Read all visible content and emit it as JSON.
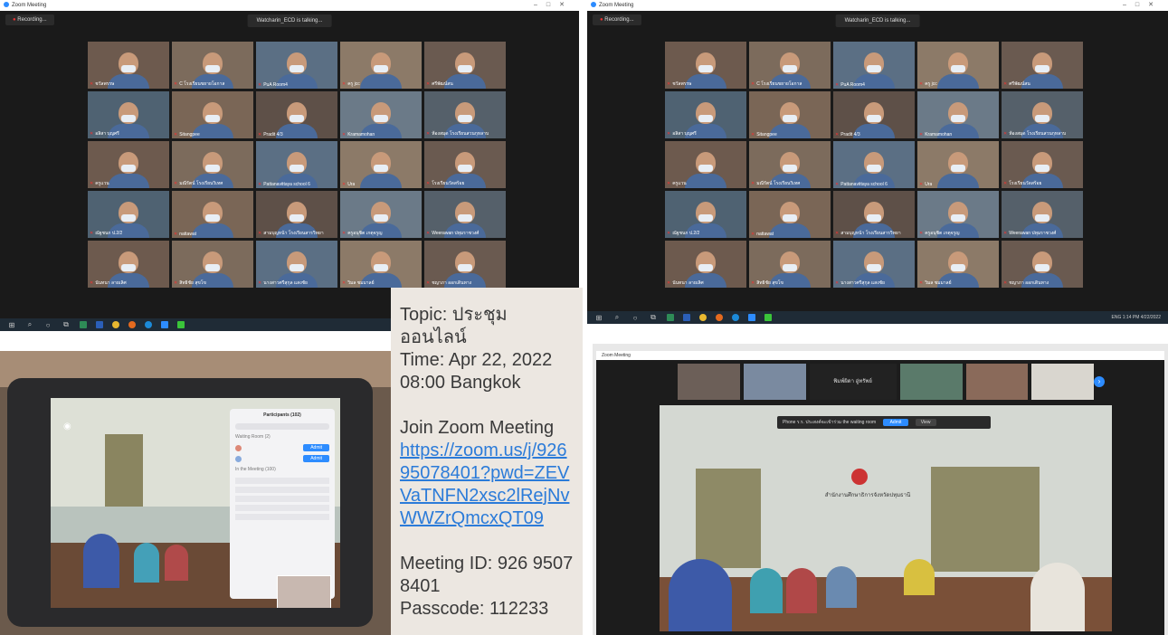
{
  "zoom_left": {
    "title": "Zoom Meeting",
    "recording": "Recording...",
    "talking": "Watcharin_ECD is talking...",
    "participants": [
      {
        "name": "ชวัลพรรษ"
      },
      {
        "name": "C โรงเรียนขยายโอกาส"
      },
      {
        "name": "PuA Room4"
      },
      {
        "name": "ครู jcc"
      },
      {
        "name": "ศรีพัฒน์สน"
      },
      {
        "name": "อลิสา บุญศรี"
      },
      {
        "name": "Sitangpee"
      },
      {
        "name": "Pradit 4/3"
      },
      {
        "name": "Kramamohan"
      },
      {
        "name": "ห้องสมุด โรงเรียนสวนกุหลาบ"
      },
      {
        "name": "ครูแวน"
      },
      {
        "name": "มณีรัตน์ โรงเรียนวิเทศ"
      },
      {
        "name": "Pattanavittaya school 6"
      },
      {
        "name": "Ura"
      },
      {
        "name": "โรงเรียนวัดสร้อย"
      },
      {
        "name": "ณัฐชนก ป.2/2"
      },
      {
        "name": "nattawat"
      },
      {
        "name": "สามบุญหน้า โรงเรียนสารวิทยา"
      },
      {
        "name": "ครูอนุชิต เกตุจรูญ"
      },
      {
        "name": "Weerawan ปทุมราชวงศ์"
      },
      {
        "name": "นันทนา ลายเลิศ"
      },
      {
        "name": "สิทธิชัย สุขโข"
      },
      {
        "name": "นางสาวศรีสุกุล แสงชัย"
      },
      {
        "name": "วิมล ชมมาลย์"
      },
      {
        "name": "ชญาภา ออกเดินทาง"
      }
    ]
  },
  "zoom_right": {
    "title": "Zoom Meeting",
    "recording": "Recording...",
    "talking": "Watcharin_ECD is talking...",
    "participants": [
      {
        "name": "ชวัลพรรษ"
      },
      {
        "name": "C โรงเรียนขยายโอกาส"
      },
      {
        "name": "PuA Room4"
      },
      {
        "name": "ครู jcc"
      },
      {
        "name": "ศรีพัฒน์สน"
      },
      {
        "name": "อลิสา บุญศรี"
      },
      {
        "name": "Sitangpee"
      },
      {
        "name": "Pradit 4/3"
      },
      {
        "name": "Kramamohan"
      },
      {
        "name": "ห้องสมุด โรงเรียนสวนกุหลาบ"
      },
      {
        "name": "ครูแวน"
      },
      {
        "name": "มณีรัตน์ โรงเรียนวิเทศ"
      },
      {
        "name": "Pattanavittaya school 6"
      },
      {
        "name": "Ura"
      },
      {
        "name": "โรงเรียนวัดสร้อย"
      },
      {
        "name": "ณัฐชนก ป.2/2"
      },
      {
        "name": "nattawat"
      },
      {
        "name": "สามบุญหน้า โรงเรียนสารวิทยา"
      },
      {
        "name": "ครูอนุชิต เกตุจรูญ"
      },
      {
        "name": "Weerawan ปทุมราชวงศ์"
      },
      {
        "name": "นันทนา ลายเลิศ"
      },
      {
        "name": "สิทธิชัย สุขโข"
      },
      {
        "name": "นางสาวศรีสุกุล แสงชัย"
      },
      {
        "name": "วิมล ชมมาลย์"
      },
      {
        "name": "ชญาภา ออกเดินทาง"
      }
    ],
    "tray": "ENG  1:14 PM  4/22/2022"
  },
  "tablet": {
    "panel_title": "Participants (102)",
    "waiting": "Waiting Room (2)",
    "in_meeting": "In the Meeting (100)",
    "admit": "Admit"
  },
  "room_screen": {
    "title": "Zoom Meeting",
    "top_name": "พิมพ์ผิดา อู่ทรัพย์",
    "banner": "Phone ร.ร. ประสงค์จะเข้าร่วม the waiting room",
    "admit": "Admit",
    "view": "View",
    "office_sign": "สำนักงานศึกษาธิการจังหวัดปทุมธานี"
  },
  "invite": {
    "topic": "Topic: ประชุมออนไลน์",
    "time": "Time: Apr 22, 2022 08:00 Bangkok",
    "join_label": "Join Zoom Meeting",
    "link": "https://zoom.us/j/92695078401?pwd=ZEVVaTNFN2xsc2lRejNvWWZrQmcxQT09",
    "meeting_id": "Meeting ID: 926 9507 8401",
    "passcode": "Passcode: 112233"
  },
  "colors": {
    "zoom_blue": "#2d8cff",
    "link_blue": "#2b7bd9",
    "note_bg": "#ece7e1",
    "zoom_dark": "#1a1a1a"
  }
}
